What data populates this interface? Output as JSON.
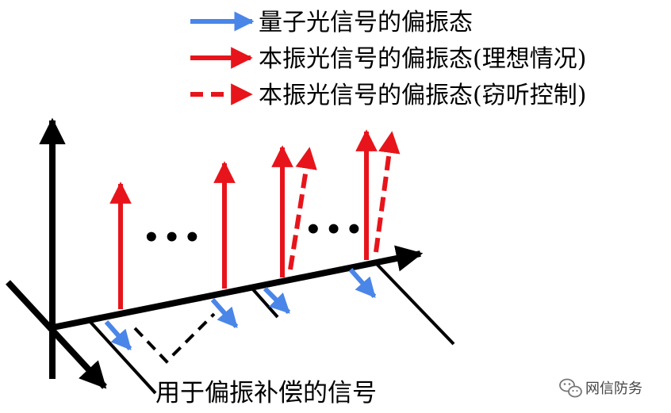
{
  "legend": [
    {
      "label": "量子光信号的偏振态",
      "style": "solid",
      "color": "#4a86e8",
      "icon": "blue-arrow-icon"
    },
    {
      "label": "本振光信号的偏振态(理想情况)",
      "style": "solid",
      "color": "#e8141b",
      "icon": "red-arrow-icon"
    },
    {
      "label": "本振光信号的偏振态(窃听控制)",
      "style": "dashed",
      "color": "#e8141b",
      "icon": "red-dashed-arrow-icon"
    }
  ],
  "diagram": {
    "ellipsis": [
      "•••",
      "•••"
    ],
    "caption": "用于偏振补偿的信号"
  },
  "watermark": {
    "icon": "wechat-icon",
    "text": "网信防务"
  },
  "colors": {
    "quantum": "#4a86e8",
    "local": "#e8141b",
    "axis": "#000000"
  }
}
